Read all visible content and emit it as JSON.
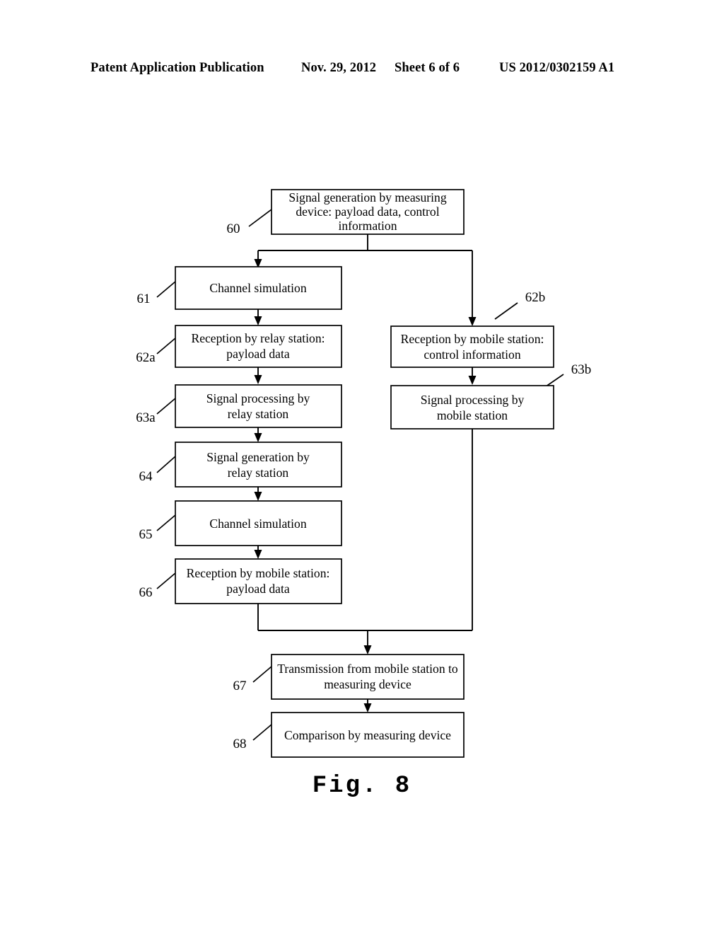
{
  "header": {
    "left": "Patent Application Publication",
    "date": "Nov. 29, 2012",
    "sheet": "Sheet 6 of 6",
    "publication_number": "US 2012/0302159 A1"
  },
  "figure": {
    "caption": "Fig.  8",
    "type": "flowchart",
    "nodes": [
      {
        "ref": "60",
        "lines": [
          "Signal generation by measuring",
          "device: payload data, control",
          "information"
        ],
        "column": "center-top"
      },
      {
        "ref": "61",
        "lines": [
          "Channel simulation"
        ],
        "column": "left"
      },
      {
        "ref": "62a",
        "lines": [
          "Reception by relay station:",
          "payload data"
        ],
        "column": "left"
      },
      {
        "ref": "62b",
        "lines": [
          "Reception by mobile station:",
          "control information"
        ],
        "column": "right"
      },
      {
        "ref": "63a",
        "lines": [
          "Signal processing by",
          "relay station"
        ],
        "column": "left"
      },
      {
        "ref": "63b",
        "lines": [
          "Signal processing  by",
          "mobile station"
        ],
        "column": "right"
      },
      {
        "ref": "64",
        "lines": [
          "Signal generation by",
          "relay station"
        ],
        "column": "left"
      },
      {
        "ref": "65",
        "lines": [
          "Channel simulation"
        ],
        "column": "left"
      },
      {
        "ref": "66",
        "lines": [
          "Reception by mobile station:",
          "payload data"
        ],
        "column": "left"
      },
      {
        "ref": "67",
        "lines": [
          "Transmission from mobile station to",
          "measuring device"
        ],
        "column": "center-bottom"
      },
      {
        "ref": "68",
        "lines": [
          "Comparison by measuring device"
        ],
        "column": "center-bottom"
      }
    ]
  },
  "colors": {
    "ink": "#000000",
    "paper": "#ffffff"
  }
}
